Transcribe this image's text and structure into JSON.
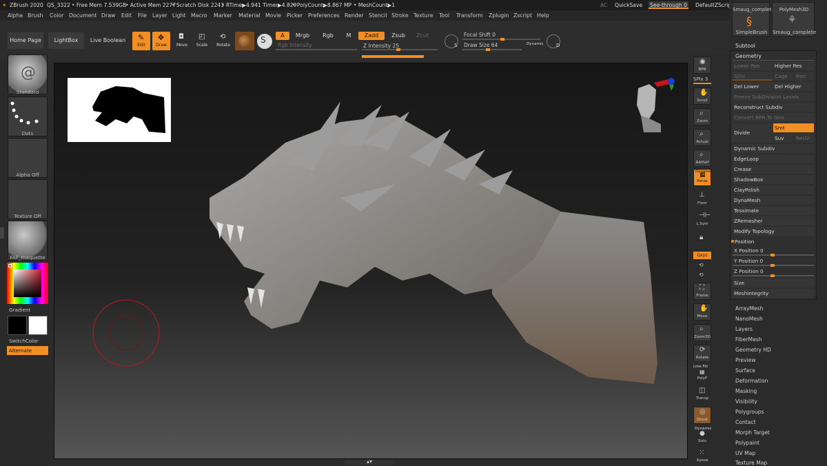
{
  "titlebar": {
    "app": "ZBrush 2020",
    "doc": "QS_3322",
    "free_mem": "• Free Mem 7.539GB",
    "active_mem": "• Active Mem 2277",
    "scratch": "• Scratch Disk 2243",
    "rtime": "• RTime▶4.941 Timer▶4.829",
    "polycount": "• PolyCount▶8.867 MP",
    "meshcount": "• MeshCount▶1",
    "ac": "AC",
    "quicksave": "QuickSave",
    "seethrough": "See-through  0",
    "defaultzscript": "DefaultZScript"
  },
  "menu": [
    "Alpha",
    "Brush",
    "Color",
    "Document",
    "Draw",
    "Edit",
    "File",
    "Layer",
    "Light",
    "Macro",
    "Marker",
    "Material",
    "Movie",
    "Picker",
    "Preferences",
    "Render",
    "Stencil",
    "Stroke",
    "Texture",
    "Tool",
    "Transform",
    "Zplugin",
    "Zscript",
    "Help"
  ],
  "toolbar": {
    "home_page": "Home Page",
    "lightbox": "LightBox",
    "live_boolean": "Live Boolean",
    "edit": "Edit",
    "draw": "Draw",
    "move": "Move",
    "scale": "Scale",
    "rotate": "Rotate",
    "a": "A",
    "mrgb": "Mrgb",
    "rgb": "Rgb",
    "m": "M",
    "zadd": "Zadd",
    "zsub": "Zsub",
    "zcut": "Zcut",
    "rgb_intensity": "Rgb Intensity",
    "z_intensity": "Z Intensity 25",
    "focal_shift": "Focal Shift 0",
    "draw_size": "Draw Size 64",
    "dynamic": "Dynamic",
    "s": "S",
    "d": "D"
  },
  "left_tray": {
    "brush": "Standard",
    "stroke": "Dots",
    "alpha": "Alpha Off",
    "texture": "Texture Off",
    "material": "FAF_maquette",
    "gradient": "Gradient",
    "switch_color": "SwitchColor",
    "alternate": "Alternate"
  },
  "right_shelf": {
    "bpr": "BPR",
    "spix": "SPix 3",
    "scroll": "Scroll",
    "zoom": "Zoom",
    "actual": "Actual",
    "aahalf": "AAHalf",
    "dynamic": "Dynamic",
    "persp": "Persp",
    "floor": "Floor",
    "lsym": "L.Sym",
    "xyz": "Qxyz",
    "frame": "Frame",
    "move": "Move",
    "zoom3d": "Zoom3D",
    "rotate": "Rotate",
    "line_fill": "Line Fill",
    "polyf": "PolyF",
    "transp": "Transp",
    "ghost": "Ghost",
    "dynamic2": "Dynamic",
    "solo": "Solo",
    "xpose": "Xpose"
  },
  "tool_panel": {
    "thumb1_label": "Smaug_complete",
    "thumb2_label": "PolyMesh3D",
    "simplebrush": "SimpleBrush",
    "smaug": "Smaug_complete",
    "subtool": "Subtool",
    "geometry": "Geometry",
    "lower_res": "Lower Res",
    "higher_res": "Higher Res",
    "sdiv": "SDiv",
    "cage": "Cage",
    "rstr": "Rstr",
    "del_lower": "Del Lower",
    "del_higher": "Del Higher",
    "freeze": "Freeze SubDivision Levels",
    "reconstruct": "Reconstruct Subdiv",
    "convert_bpr": "Convert BPR To Geo",
    "divide": "Divide",
    "smt": "Smt",
    "suv": "Suv",
    "reuv": "ReUV",
    "items": [
      "Dynamic Subdiv",
      "EdgeLoop",
      "Crease",
      "ShadowBox",
      "ClayPolish",
      "DynaMesh",
      "Tessimate",
      "ZRemesher",
      "Modify Topology"
    ],
    "position": "Position",
    "x_pos": "X Position 0",
    "y_pos": "Y Position 0",
    "z_pos": "Z Position 0",
    "size": "Size",
    "meshintegrity": "MeshIntegrity",
    "subpalettes": [
      "ArrayMesh",
      "NanoMesh",
      "Layers",
      "FiberMesh",
      "Geometry HD",
      "Preview",
      "Surface",
      "Deformation",
      "Masking",
      "Visibility",
      "Polygroups",
      "Contact",
      "Morph Target",
      "Polypaint",
      "UV Map",
      "Texture Map"
    ]
  },
  "colors": {
    "accent": "#f18f24",
    "bg": "#2b2b2b",
    "panel_row": "#353535",
    "brush_ring": "#c0161a"
  }
}
